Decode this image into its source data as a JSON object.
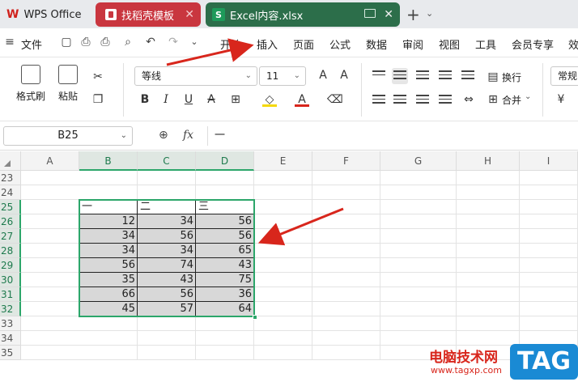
{
  "titlebar": {
    "app_name": "WPS Office",
    "tabs": [
      {
        "label": "找稻壳模板"
      },
      {
        "label": "Excel内容.xlsx"
      }
    ]
  },
  "menubar": {
    "file": "文件",
    "items": [
      "开始",
      "插入",
      "页面",
      "公式",
      "数据",
      "审阅",
      "视图",
      "工具",
      "会员专享",
      "效"
    ]
  },
  "ribbon": {
    "format_painter": "格式刷",
    "paste": "粘贴",
    "font_name": "等线",
    "font_size": "11",
    "wrap_text": "换行",
    "merge": "合并",
    "number_format": "常规"
  },
  "formula_bar": {
    "cell_ref": "B25",
    "fx": "fx",
    "content": "一"
  },
  "grid": {
    "columns": [
      "A",
      "B",
      "C",
      "D",
      "E",
      "F",
      "G",
      "H",
      "I"
    ],
    "rows": [
      "23",
      "24",
      "25",
      "26",
      "27",
      "28",
      "29",
      "30",
      "31",
      "32",
      "33",
      "34",
      "35"
    ],
    "table_headers": [
      "一",
      "二",
      "三"
    ],
    "table_rows": [
      [
        12,
        34,
        56
      ],
      [
        34,
        56,
        56
      ],
      [
        34,
        34,
        65
      ],
      [
        56,
        74,
        43
      ],
      [
        35,
        43,
        75
      ],
      [
        66,
        56,
        36
      ],
      [
        45,
        57,
        64
      ]
    ]
  },
  "watermark": {
    "title": "电脑技术网",
    "url": "www.tagxp.com",
    "tag": "TAG"
  },
  "colors": {
    "accent_green": "#2ca66a",
    "tab_red": "#c9363f",
    "tab_green": "#2c6e4a",
    "arrow_red": "#d8261c"
  }
}
